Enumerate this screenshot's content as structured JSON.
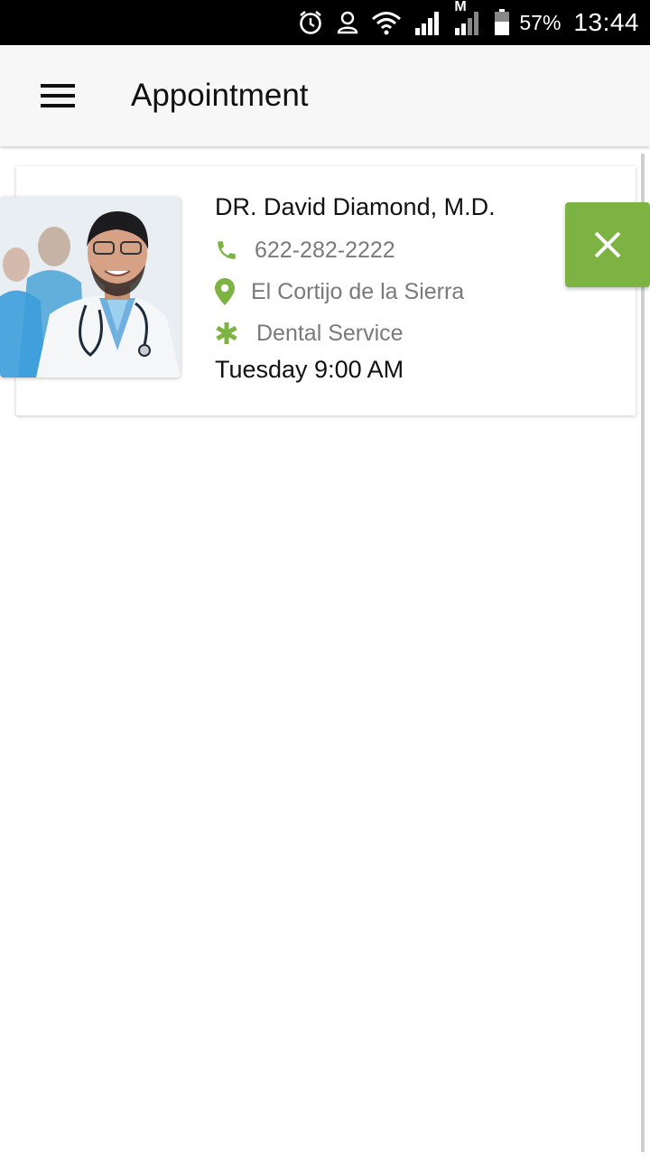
{
  "status_bar": {
    "battery_percent": "57%",
    "time": "13:44",
    "network_label": "M",
    "icons": [
      "alarm-icon",
      "account-icon",
      "wifi-icon",
      "signal-icon",
      "signal-icon",
      "battery-icon"
    ]
  },
  "app_bar": {
    "title": "Appointment",
    "menu_icon": "hamburger-icon"
  },
  "appointment": {
    "doctor_name": "DR. David Diamond, M.D.",
    "phone": "622-282-2222",
    "location": "El Cortijo de la Sierra",
    "service": "Dental Service",
    "time": "Tuesday 9:00 AM",
    "photo": "doctor-portrait",
    "remove_icon": "close-icon"
  },
  "colors": {
    "accent": "#7cb342",
    "app_bar_bg": "#f7f7f7",
    "status_bar_bg": "#000000",
    "secondary_text": "#7a7a7a",
    "primary_text": "#111111"
  }
}
